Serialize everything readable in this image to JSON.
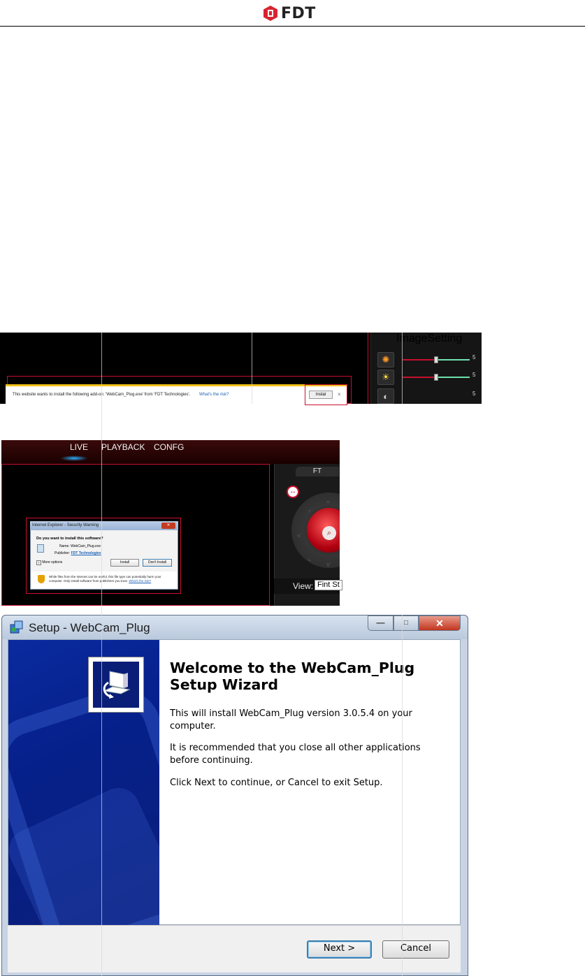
{
  "header": {
    "logo_text": "FDT"
  },
  "shot1": {
    "panel_title": "ImageSetting",
    "slider_values": [
      "5",
      "5",
      "5"
    ],
    "ie_bar": {
      "message": "This website wants to install the following add-on: 'WebCam_Plug.exe' from 'FDT Technologies'.",
      "risk_link": "What's the risk?",
      "install_label": "Instal",
      "close_glyph": "×"
    }
  },
  "shot2": {
    "nav": [
      "LIVE",
      "PLAYBACK",
      "CONFG"
    ],
    "panel_tab": "FT",
    "view_label": "View:",
    "view_value": "Fint St",
    "security_window": {
      "title": "Internet Explorer - Security Warning",
      "question": "Do you want to install this software?",
      "name_label": "Name:",
      "name_value": "WebCam_Plug.exe",
      "publisher_label": "Publisher:",
      "publisher_value": "FDT Technologies",
      "more_options": "More options",
      "install_button": "Install",
      "dont_install_button": "Don't Install",
      "warning_text": "While files from the Internet can be useful, this file type can potentially harm your computer. Only install software from publishers you trust.",
      "warning_link": "What's the risk?"
    }
  },
  "wizard": {
    "title": "Setup - WebCam_Plug",
    "heading": "Welcome to the WebCam_Plug Setup Wizard",
    "para1": "This will install WebCam_Plug version 3.0.5.4 on your computer.",
    "para2": "It is recommended that you close all other applications before continuing.",
    "para3": "Click Next to continue, or Cancel to exit Setup.",
    "next_button": "Next >",
    "cancel_button": "Cancel",
    "controls": {
      "min": "—",
      "max": "□",
      "close": "✕"
    }
  }
}
